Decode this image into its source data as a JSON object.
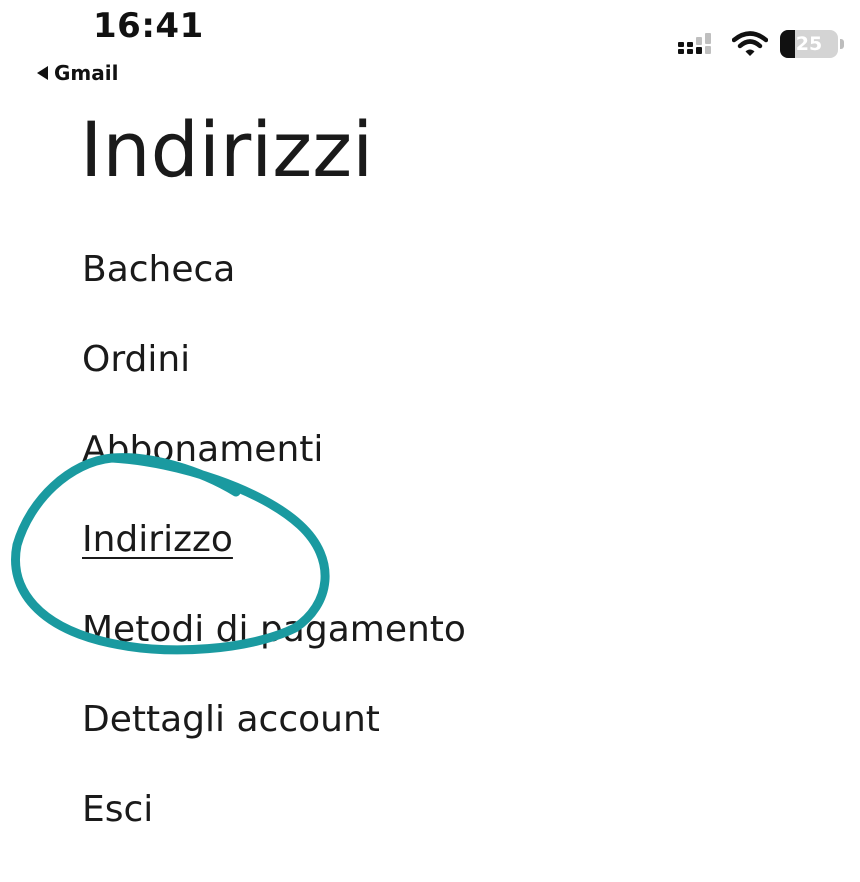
{
  "status_bar": {
    "time": "16:41",
    "back_app": "Gmail",
    "battery_level": "25",
    "battery_fraction": 0.25,
    "icons": [
      "cellular-signal-icon",
      "wifi-icon",
      "battery-icon"
    ]
  },
  "page": {
    "title": "Indirizzi"
  },
  "menu": {
    "items": [
      {
        "label": "Bacheca",
        "active": false
      },
      {
        "label": "Ordini",
        "active": false
      },
      {
        "label": "Abbonamenti",
        "active": false
      },
      {
        "label": "Indirizzo",
        "active": true
      },
      {
        "label": "Metodi di pagamento",
        "active": false
      },
      {
        "label": "Dettagli account",
        "active": false
      },
      {
        "label": "Esci",
        "active": false
      }
    ]
  },
  "annotation": {
    "color": "#1a9aa0",
    "shape": "hand-drawn-circle",
    "target": "Indirizzo"
  },
  "colors": {
    "text": "#1a1a1a",
    "background": "#ffffff"
  }
}
